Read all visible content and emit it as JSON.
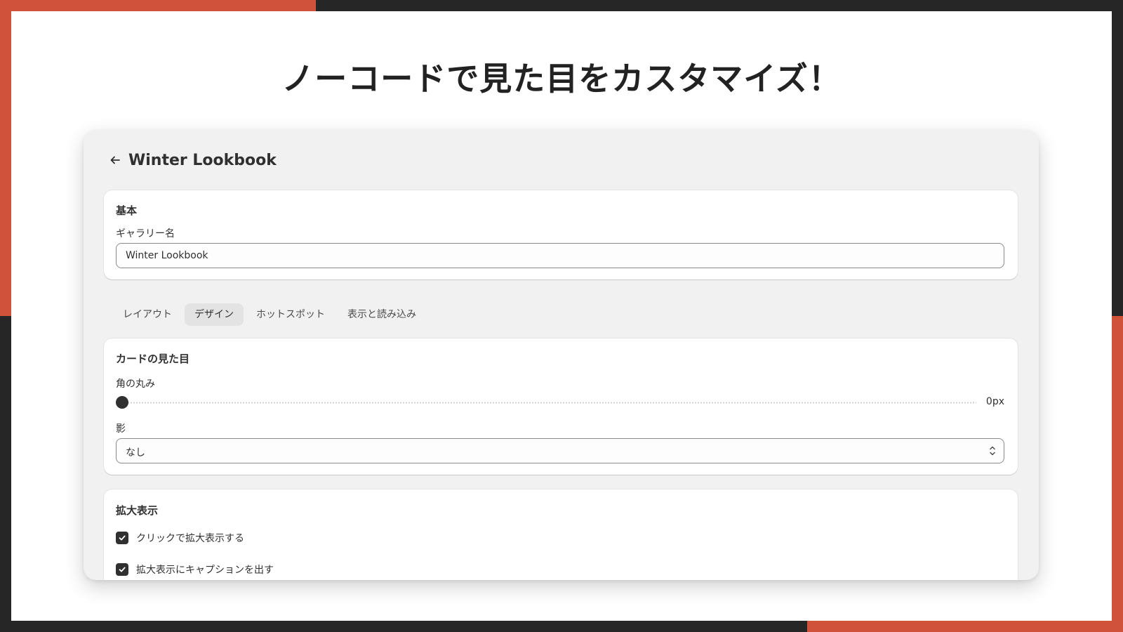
{
  "slide": {
    "headline": "ノーコードで見た目をカスタマイズ！"
  },
  "header": {
    "title": "Winter Lookbook"
  },
  "basic": {
    "title": "基本",
    "gallery_name_label": "ギャラリー名",
    "gallery_name_value": "Winter Lookbook"
  },
  "tabs": [
    {
      "label": "レイアウト",
      "active": false
    },
    {
      "label": "デザイン",
      "active": true
    },
    {
      "label": "ホットスポット",
      "active": false
    },
    {
      "label": "表示と読み込み",
      "active": false
    }
  ],
  "card_appearance": {
    "title": "カードの見た目",
    "corner_radius_label": "角の丸み",
    "corner_radius_value": "0px",
    "corner_radius_fraction": 0,
    "shadow_label": "影",
    "shadow_value": "なし"
  },
  "zoom": {
    "title": "拡大表示",
    "options": [
      {
        "label": "クリックで拡大表示する",
        "checked": true
      },
      {
        "label": "拡大表示にキャプションを出す",
        "checked": true
      }
    ]
  },
  "colors": {
    "accent": "#d0523b",
    "dark": "#262626",
    "panel": "#f1f1f1"
  },
  "icons": {
    "back": "arrow-left-icon",
    "select": "chevron-up-down-icon",
    "check": "checkmark-icon"
  }
}
